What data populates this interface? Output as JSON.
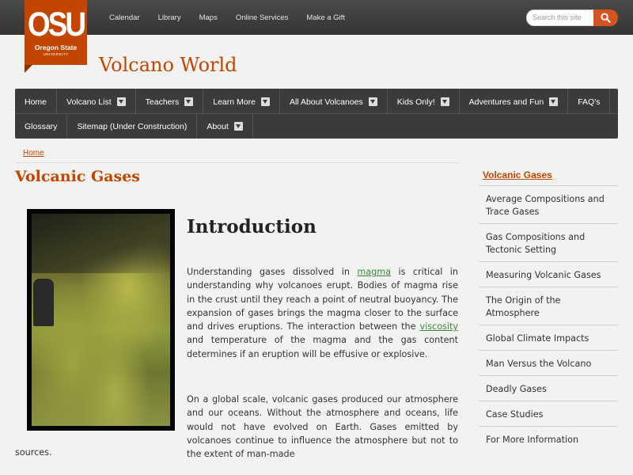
{
  "header": {
    "logo_text": "OSU",
    "logo_sub": "Oregon State",
    "logo_uni": "UNIVERSITY",
    "site_title": "Volcano World",
    "top_links": [
      "Calendar",
      "Library",
      "Maps",
      "Online Services",
      "Make a Gift"
    ],
    "search_placeholder": "Search this site"
  },
  "nav": {
    "row1": [
      {
        "label": "Home",
        "dropdown": false
      },
      {
        "label": "Volcano List",
        "dropdown": true
      },
      {
        "label": "Teachers",
        "dropdown": true
      },
      {
        "label": "Learn More",
        "dropdown": true
      },
      {
        "label": "All About Volcanoes",
        "dropdown": true
      },
      {
        "label": "Kids Only!",
        "dropdown": true
      },
      {
        "label": "Adventures and Fun",
        "dropdown": true
      },
      {
        "label": "FAQ's",
        "dropdown": false
      }
    ],
    "row2": [
      {
        "label": "Glossary",
        "dropdown": false
      },
      {
        "label": "Sitemap (Under Construction)",
        "dropdown": false
      },
      {
        "label": "About",
        "dropdown": true
      }
    ]
  },
  "breadcrumb": "Home",
  "page_title": "Volcanic Gases",
  "content": {
    "heading": "Introduction",
    "p1_a": "Understanding gases dissolved in ",
    "p1_link1": "magma",
    "p1_b": " is critical in understanding why volcanoes erupt. Bodies of magma rise in the crust until they reach a point of neutral buoyancy. The expansion of gases brings the magma closer to the surface and drives eruptions. The interaction between the ",
    "p1_link2": "viscosity",
    "p1_c": " and temperature of the magma and the gas content determines if an eruption will be effusive or explosive.",
    "p2": "On a global scale, volcanic gases produced our atmosphere and our oceans. Without the atmosphere and oceans, life would not have evolved on Earth. Gases emitted by volcanoes continue to influence the atmosphere but not to the extent of man-made",
    "p2_tail": "sources."
  },
  "sidebar": {
    "heading": "Volcanic Gases",
    "items": [
      "Average Compositions and Trace Gases",
      "Gas Compositions and Tectonic Setting",
      "Measuring Volcanic Gases",
      "The Origin of the Atmosphere",
      "Global Climate Impacts",
      "Man Versus the Volcano",
      "Deadly Gases",
      "Case Studies",
      "For More Information"
    ]
  },
  "colors": {
    "accent": "#c34500",
    "nav_bg": "#3b3b3b",
    "link_green": "#3b8a3b"
  }
}
